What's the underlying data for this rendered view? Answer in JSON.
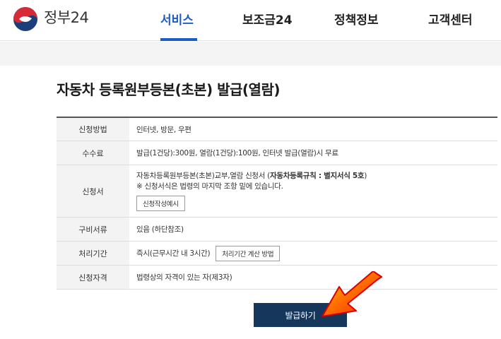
{
  "header": {
    "brand": "정부24",
    "nav": [
      "서비스",
      "보조금24",
      "정책정보",
      "고객센터"
    ]
  },
  "page": {
    "title": "자동차 등록원부등본(초본) 발급(열람)"
  },
  "table": {
    "rows": [
      {
        "label": "신청방법",
        "value": "인터넷, 방문, 우편"
      },
      {
        "label": "수수료",
        "value": "발급(1건당):300원, 열람(1건당):100원, 인터넷 발급(열람)시 무료"
      },
      {
        "label": "신청서",
        "value_prefix": "자동차등록원부등본(초본)교부,열람 신청서 (",
        "value_bold": "자동차등록규칙 : 별지서식 5호",
        "value_suffix": ")",
        "note": "※ 신청서식은 법령의 마지막 조항 밑에 있습니다.",
        "button": "신청작성예시"
      },
      {
        "label": "구비서류",
        "value": "있음 (하단참조)"
      },
      {
        "label": "처리기간",
        "value": "즉시(근무시간 내 3시간)",
        "button": "처리기간 계산 방법"
      },
      {
        "label": "신청자격",
        "value": "법령상의 자격이 있는 자(제3자)"
      }
    ]
  },
  "actions": {
    "submit": "발급하기"
  },
  "colors": {
    "accent": "#1b5cc7",
    "submit_bg": "#16375c",
    "arrow": "#ff2a00"
  }
}
